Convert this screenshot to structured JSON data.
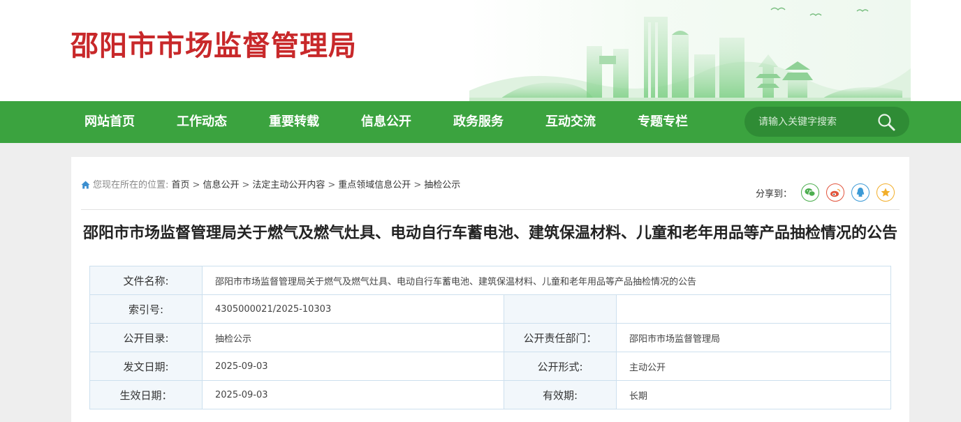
{
  "header": {
    "site_title": "邵阳市市场监督管理局"
  },
  "nav": {
    "items": [
      "网站首页",
      "工作动态",
      "重要转载",
      "信息公开",
      "政务服务",
      "互动交流",
      "专题专栏"
    ],
    "search_placeholder": "请输入关键字搜索"
  },
  "breadcrumb": {
    "lead": "您现在所在的位置:",
    "items": [
      "首页",
      "信息公开",
      "法定主动公开内容",
      "重点领域信息公开",
      "抽检公示"
    ],
    "separator": ">"
  },
  "share": {
    "label": "分享到：",
    "targets": [
      {
        "name": "wechat",
        "color": "#4cae4f"
      },
      {
        "name": "weibo",
        "color": "#e2553d"
      },
      {
        "name": "qq",
        "color": "#3c9ad6"
      },
      {
        "name": "qzone",
        "color": "#f2ae2a"
      }
    ]
  },
  "article": {
    "title": "邵阳市市场监督管理局关于燃气及燃气灶具、电动自行车蓄电池、建筑保温材料、儿童和老年用品等产品抽检情况的公告"
  },
  "info_table": {
    "file_name_label": "文件名称:",
    "file_name": "邵阳市市场监督管理局关于燃气及燃气灶具、电动自行车蓄电池、建筑保温材料、儿童和老年用品等产品抽检情况的公告",
    "index_label": "索引号:",
    "index": "4305000021/2025-10303",
    "catalog_label": "公开目录:",
    "catalog": "抽检公示",
    "dept_label": "公开责任部门：",
    "dept": "邵阳市市场监督管理局",
    "issue_date_label": "发文日期:",
    "issue_date": "2025-09-03",
    "form_label": "公开形式:",
    "form": "主动公开",
    "effective_date_label": "生效日期：",
    "effective_date": "2025-09-03",
    "validity_label": "有效期:",
    "validity": "长期"
  },
  "colors": {
    "brand_red": "#c8282a",
    "nav_green": "#3ba33f",
    "search_green": "#2f8c35"
  }
}
